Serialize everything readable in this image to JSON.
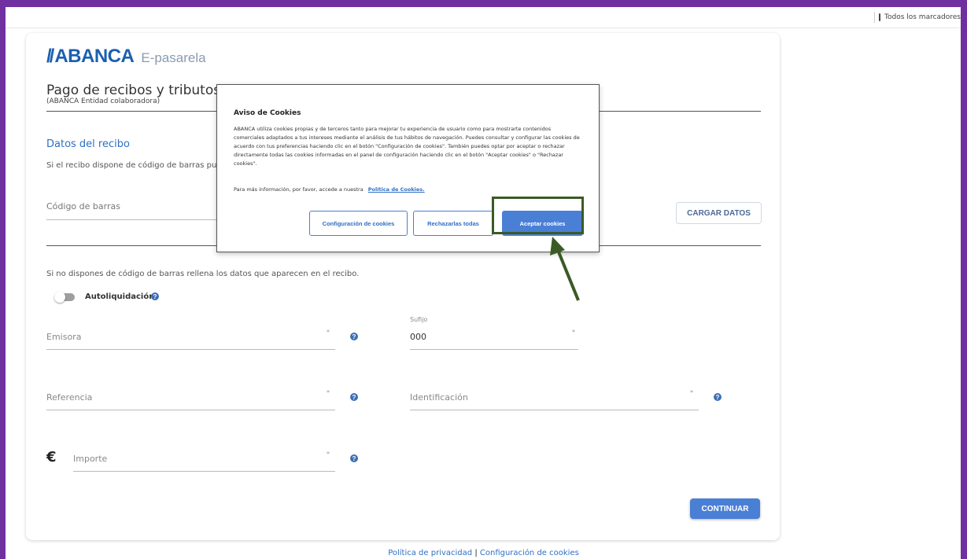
{
  "browser": {
    "bookmarks_folder": "Todos los marcadores"
  },
  "header": {
    "logo_slashes": "//",
    "logo_brand": "ABANCA",
    "logo_sub": "E-pasarela",
    "title": "Pago de recibos y tributos",
    "subtitle": "(ABANCA Entidad colaboradora)"
  },
  "receipt": {
    "section_title": "Datos del recibo",
    "helper": "Si el recibo dispone de código de barras pu",
    "barcode_label": "Código de barras",
    "load_button": "CARGAR DATOS",
    "manual_text": "Si no dispones de código de barras rellena los datos que aparecen en el recibo.",
    "toggle_label": "Autoliquidación",
    "toggle_on": false
  },
  "fields": {
    "emisora": {
      "label": "Emisora",
      "required": "*"
    },
    "sufijo": {
      "label": "Sufijo",
      "value": "000",
      "required": "*"
    },
    "referencia": {
      "label": "Referencia",
      "required": "*"
    },
    "identificacion": {
      "label": "Identificación",
      "required": "*"
    },
    "importe": {
      "label": "Importe",
      "required": "*",
      "currency": "€"
    }
  },
  "help_glyph": "?",
  "continue_button": "CONTINUAR",
  "footer": {
    "privacy": "Política de privacidad",
    "separator": "|",
    "cookies": "Configuración de cookies"
  },
  "cookie_modal": {
    "title": "Aviso de Cookies",
    "body": "ABANCA utiliza cookies propias y de terceros tanto para mejorar tu experiencia de usuario como para mostrarte contenidos comerciales adaptados a tus intereses mediante el análisis de tus hábitos de navegación. Puedes consultar y configurar las cookies de acuerdo con tus preferencias haciendo clic en el botón \"Configuración de cookies\". También puedes optar por aceptar o rechazar directamente todas las cookies informadas en el panel de configuración haciendo clic en el botón \"Aceptar cookies\" o \"Rechazar cookies\".",
    "more_info": "Para más información, por favor, accede a nuestra",
    "policy_link": "Política de Cookies.",
    "config_button": "Configuración de cookies",
    "reject_button": "Rechazarlas todas",
    "accept_button": "Aceptar cookies"
  },
  "colors": {
    "frame": "#7030a0",
    "brand_blue": "#1b5fb0",
    "accent": "#4a7fd6",
    "highlight": "#3b5a25"
  }
}
